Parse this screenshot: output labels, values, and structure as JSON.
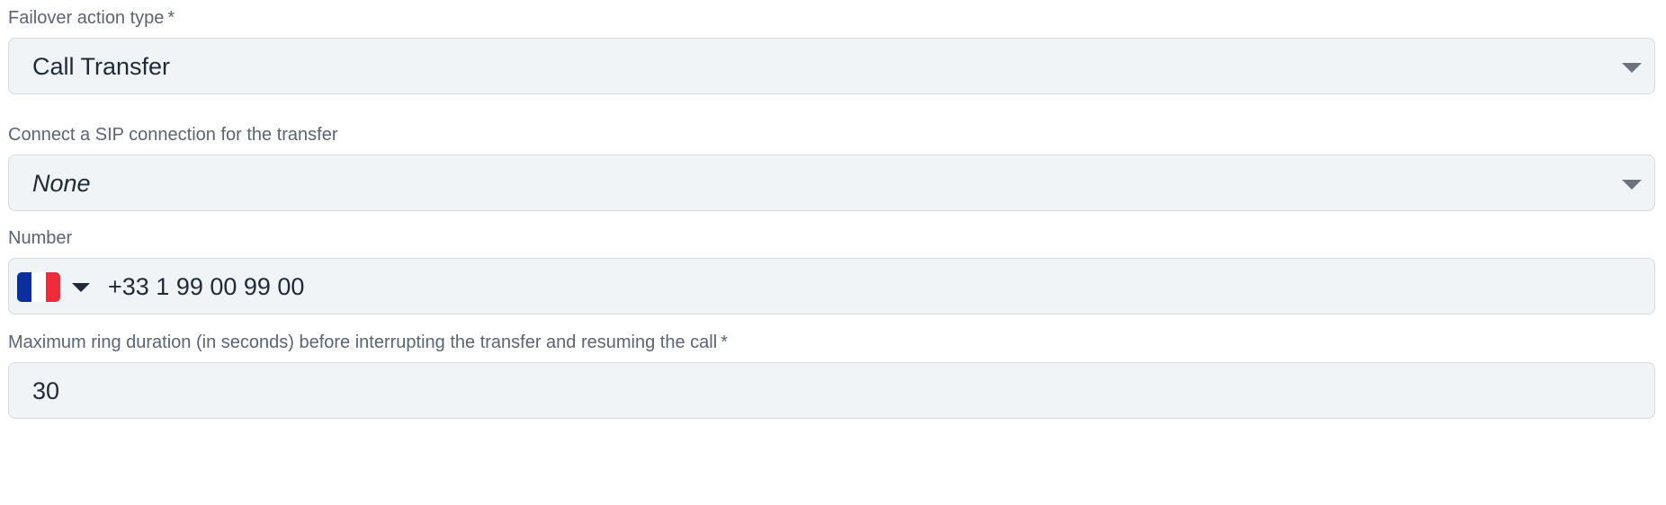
{
  "failover_action": {
    "label": "Failover action type",
    "required_mark": "*",
    "value": "Call Transfer"
  },
  "sip_connection": {
    "label": "Connect a SIP connection for the transfer",
    "value": "None"
  },
  "number": {
    "label": "Number",
    "country_flag": "france-flag",
    "value": "+33 1 99 00 99 00"
  },
  "ring_duration": {
    "label": "Maximum ring duration (in seconds) before interrupting the transfer and resuming the call",
    "required_mark": "*",
    "value": "30"
  },
  "colors": {
    "field_background": "#f1f4f7",
    "field_border": "#d3dae2",
    "label_text": "#5b6472",
    "value_text": "#1f2a37",
    "flag_blue": "#0b2f9f",
    "flag_red": "#ee2b3b"
  }
}
